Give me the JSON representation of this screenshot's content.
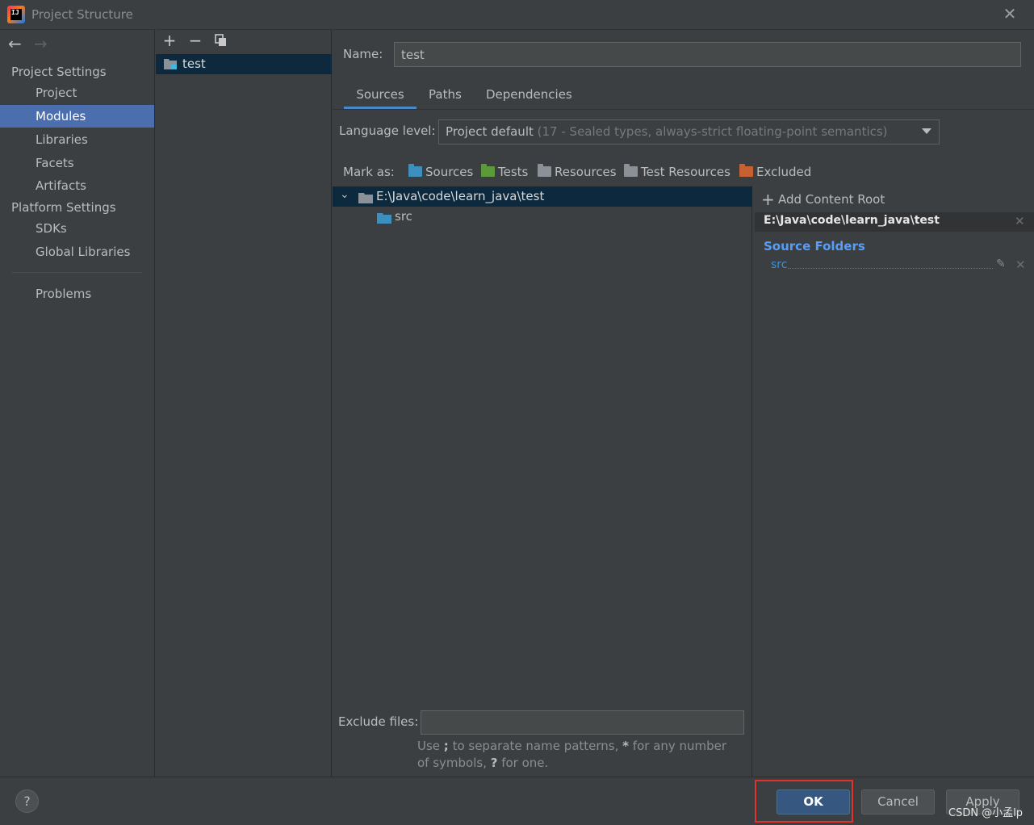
{
  "window": {
    "title": "Project Structure",
    "app_icon_text": "IJ"
  },
  "nav": {
    "back_icon": "arrow-left-icon",
    "forward_icon": "arrow-right-icon",
    "project_settings_header": "Project Settings",
    "project_settings_items": [
      "Project",
      "Modules",
      "Libraries",
      "Facets",
      "Artifacts"
    ],
    "selected_item": "Modules",
    "platform_settings_header": "Platform Settings",
    "platform_settings_items": [
      "SDKs",
      "Global Libraries"
    ],
    "problems": "Problems"
  },
  "module_list": {
    "toolbar": [
      "plus-icon",
      "minus-icon",
      "copy-icon"
    ],
    "modules": [
      "test"
    ]
  },
  "module": {
    "name_label": "Name:",
    "name_value": "test",
    "tabs": [
      "Sources",
      "Paths",
      "Dependencies"
    ],
    "active_tab": "Sources",
    "language_level_label": "Language level:",
    "language_level_value": "Project default",
    "language_level_hint": "(17 - Sealed types, always-strict floating-point semantics)",
    "mark_as_label": "Mark as:",
    "mark_as": [
      "Sources",
      "Tests",
      "Resources",
      "Test Resources",
      "Excluded"
    ],
    "tree_root": "E:\\Java\\code\\learn_java\\test",
    "tree_child": "src",
    "add_content_root": "Add Content Root",
    "content_root_path": "E:\\Java\\code\\learn_java\\test",
    "source_folders_label": "Source Folders",
    "source_folder": "src",
    "exclude_files_label": "Exclude files:",
    "exclude_files_value": "",
    "exclude_hint_1": "Use ",
    "exclude_hint_semicolon": ";",
    "exclude_hint_2": " to separate name patterns, ",
    "exclude_hint_star": "*",
    "exclude_hint_3": " for any number of symbols, ",
    "exclude_hint_q": "?",
    "exclude_hint_4": " for one."
  },
  "footer": {
    "help": "?",
    "ok": "OK",
    "cancel": "Cancel",
    "apply": "Apply",
    "watermark": "CSDN @小孟lp"
  },
  "colors": {
    "selection": "#4b6eaf",
    "tree_selection": "#0d293e",
    "source_folders": "#589df6",
    "highlight_box": "#e0322b"
  }
}
